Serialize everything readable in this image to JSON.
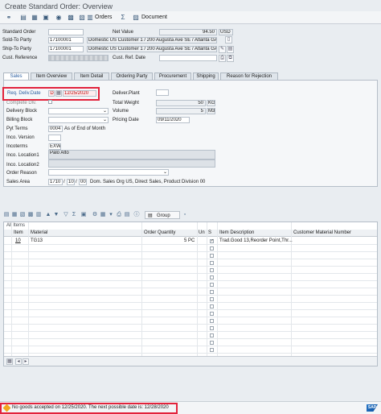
{
  "window": {
    "title": "Create Standard Order: Overview"
  },
  "toolbar": {
    "orders_label": "Orders",
    "document_label": "Document"
  },
  "header": {
    "standard_order_label": "Standard Order",
    "net_value_label": "Net Value",
    "net_value": "94.50",
    "currency": "USD",
    "sold_to_label": "Sold-To Party",
    "sold_to_id": "17100001",
    "sold_to_desc": "Domestic US Customer 1 / 200 Augusta Ave SE / Atlanta GA ...",
    "ship_to_label": "Ship-To Party",
    "ship_to_id": "17100001",
    "ship_to_desc": "Domestic US Customer 1 / 200 Augusta Ave SE / Atlanta GA ...",
    "cust_ref_label": "Cust. Reference",
    "cust_ref_date_label": "Cust. Ref. Date"
  },
  "tabs": [
    "Sales",
    "Item Overview",
    "Item Detail",
    "Ordering Party",
    "Procurement",
    "Shipping",
    "Reason for Rejection"
  ],
  "sales": {
    "req_deliv_date_label": "Req. Deliv.Date",
    "req_deliv_date_unit": "D",
    "req_deliv_date": "12/25/2020",
    "complete_dlv_label": "Complete Dlv.",
    "delivery_block_label": "Delivery Block",
    "billing_block_label": "Billing Block",
    "pyt_terms_label": "Pyt Terms",
    "pyt_terms_code": "0004",
    "pyt_terms_desc": "As of End of Month",
    "inco_version_label": "Inco. Version",
    "incoterms_label": "Incoterms",
    "incoterms_value": "EXW",
    "inco_loc1_label": "Inco. Location1",
    "inco_loc1_value": "Palo Alto",
    "inco_loc2_label": "Inco. Location2",
    "order_reason_label": "Order Reason",
    "sales_area_label": "Sales Area",
    "sales_org": "1710",
    "dist_channel": "10",
    "division": "00",
    "sales_area_desc": "Dom. Sales Org US, Direct Sales, Product Division 00",
    "deliver_plant_label": "Deliver.Plant",
    "total_weight_label": "Total Weight",
    "total_weight": "50",
    "total_weight_unit": "KG",
    "volume_label": "Volume",
    "volume": "5",
    "volume_unit": "M3",
    "pricing_date_label": "Pricing Date",
    "pricing_date": "09/11/2020"
  },
  "items": {
    "group_label": "Group",
    "section_label": "All Items",
    "columns": [
      "Item",
      "Material",
      "Order Quantity",
      "Un",
      "S",
      "Item Description",
      "Customer Material Number"
    ],
    "rows": [
      {
        "item": "10",
        "material": "TG13",
        "qty": "5",
        "unit": "PC",
        "checked": "✓",
        "desc": "Trad.Good 13,Reorder Point,Thr..."
      }
    ]
  },
  "status_bar": {
    "message": "No goods accepted on 12/25/2020. The next possible date is: 12/28/2020"
  },
  "brand": {
    "logo_text": "SAP"
  }
}
